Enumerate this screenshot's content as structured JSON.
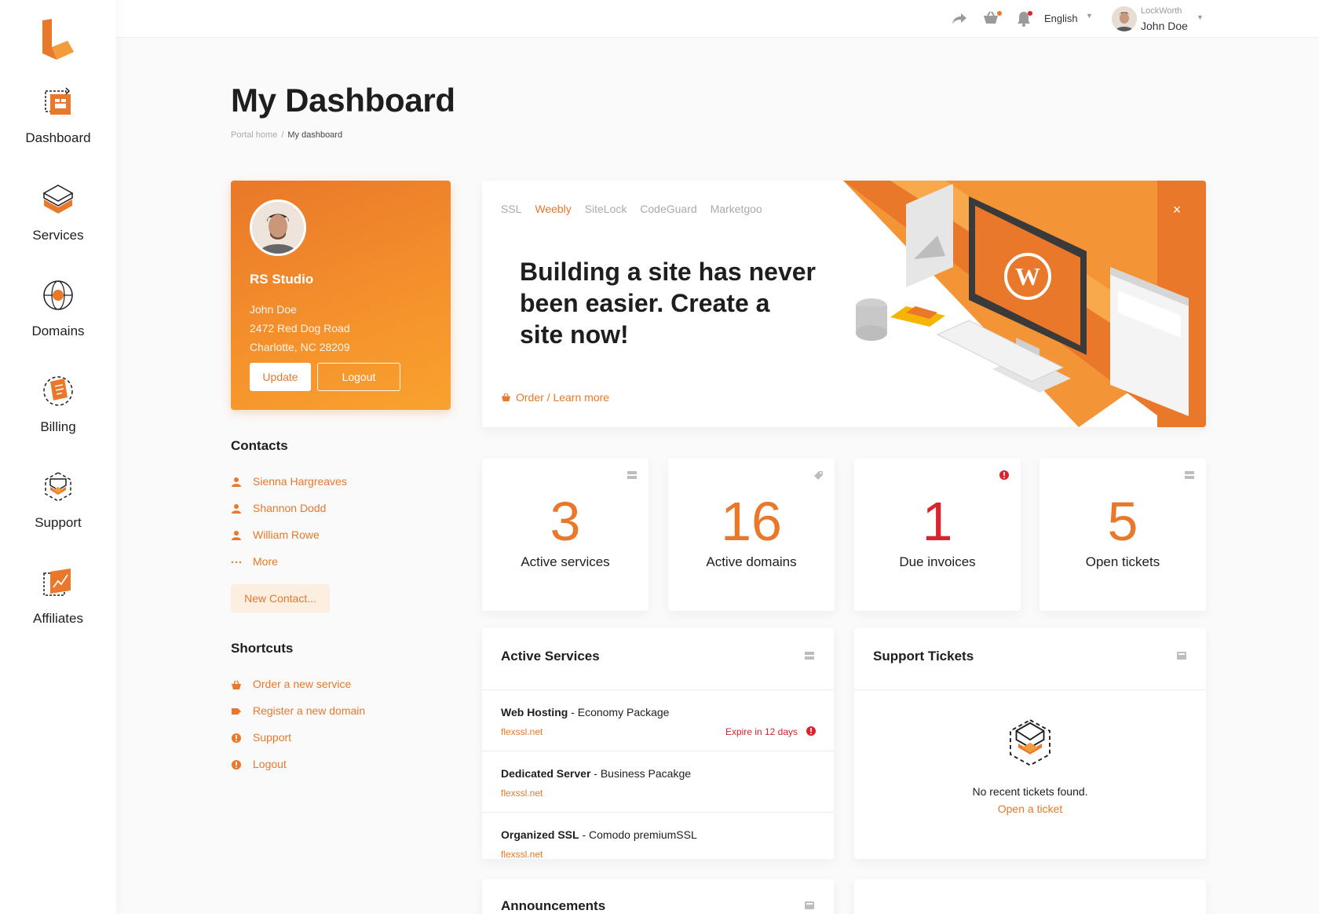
{
  "sidebar": {
    "items": [
      {
        "label": "Dashboard",
        "icon": "dashboard-icon"
      },
      {
        "label": "Services",
        "icon": "services-icon"
      },
      {
        "label": "Domains",
        "icon": "domains-icon"
      },
      {
        "label": "Billing",
        "icon": "billing-icon"
      },
      {
        "label": "Support",
        "icon": "support-icon"
      },
      {
        "label": "Affiliates",
        "icon": "affiliates-icon"
      }
    ]
  },
  "topbar": {
    "language": "English",
    "user_company": "LockWorth",
    "user_name": "John Doe"
  },
  "page": {
    "title": "My Dashboard",
    "breadcrumb": {
      "home": "Portal home",
      "separator": "/",
      "current": "My dashboard"
    }
  },
  "profile": {
    "company": "RS Studio",
    "name": "John Doe",
    "address1": "2472 Red Dog Road",
    "address2": "Charlotte, NC 28209",
    "update_label": "Update",
    "logout_label": "Logout"
  },
  "contacts": {
    "title": "Contacts",
    "items": [
      "Sienna Hargreaves",
      "Shannon Dodd",
      "William Rowe"
    ],
    "more_label": "More",
    "new_contact_label": "New Contact..."
  },
  "shortcuts": {
    "title": "Shortcuts",
    "items": [
      "Order a new service",
      "Register a new domain",
      "Support",
      "Logout"
    ]
  },
  "promo": {
    "tabs": [
      "SSL",
      "Weebly",
      "SiteLock",
      "CodeGuard",
      "Marketgoo"
    ],
    "active_tab": "Weebly",
    "headline": "Building a site has never been easier. Create a site now!",
    "link_label": "Order / Learn more",
    "close_label": "×"
  },
  "stats": [
    {
      "value": "3",
      "label": "Active services",
      "color": "#e9782a"
    },
    {
      "value": "16",
      "label": "Active domains",
      "color": "#e9782a"
    },
    {
      "value": "1",
      "label": "Due invoices",
      "color": "#d9232e"
    },
    {
      "value": "5",
      "label": "Open tickets",
      "color": "#e9782a"
    }
  ],
  "active_services": {
    "title": "Active Services",
    "items": [
      {
        "name": "Web Hosting",
        "package": " - Economy Package",
        "domain": "flexssl.net",
        "expire": "Expire in 12 days"
      },
      {
        "name": "Dedicated Server",
        "package": " - Business Pacakge",
        "domain": "flexssl.net",
        "expire": ""
      },
      {
        "name": "Organized SSL",
        "package": " - Comodo premiumSSL",
        "domain": "flexssl.net",
        "expire": ""
      }
    ]
  },
  "support_tickets": {
    "title": "Support Tickets",
    "empty_text": "No recent tickets found.",
    "open_link": "Open a ticket"
  },
  "announcements": {
    "title": "Announcements"
  },
  "colors": {
    "accent": "#e9782a",
    "danger": "#d9232e"
  }
}
